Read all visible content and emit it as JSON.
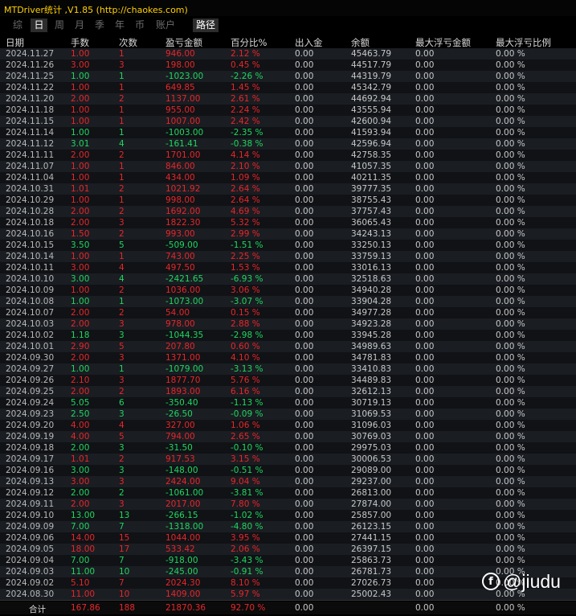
{
  "window": {
    "title": "MTDriver统计 ,V1.85 (http://chaokes.com)"
  },
  "tabs": [
    {
      "label": "综",
      "active": false
    },
    {
      "label": "日",
      "active": true
    },
    {
      "label": "周",
      "active": false
    },
    {
      "label": "月",
      "active": false
    },
    {
      "label": "季",
      "active": false
    },
    {
      "label": "年",
      "active": false
    },
    {
      "label": "币",
      "active": false
    },
    {
      "label": "账户",
      "active": false
    },
    {
      "label": "路径",
      "active": true
    }
  ],
  "columns": [
    "日期",
    "手数",
    "次数",
    "盈亏金额",
    "百分比%",
    "出入金",
    "余额",
    "最大浮亏金额",
    "最大浮亏比例"
  ],
  "rows": [
    [
      "2024.11.27",
      "1.00",
      "1",
      "946.00",
      "2.12 %",
      "0.00",
      "45463.79",
      "0.00",
      "0.00 %"
    ],
    [
      "2024.11.26",
      "3.00",
      "3",
      "198.00",
      "0.45 %",
      "0.00",
      "44517.79",
      "0.00",
      "0.00 %"
    ],
    [
      "2024.11.25",
      "1.00",
      "1",
      "-1023.00",
      "-2.26 %",
      "0.00",
      "44319.79",
      "0.00",
      "0.00 %"
    ],
    [
      "2024.11.22",
      "1.00",
      "1",
      "649.85",
      "1.45 %",
      "0.00",
      "45342.79",
      "0.00",
      "0.00 %"
    ],
    [
      "2024.11.20",
      "2.00",
      "2",
      "1137.00",
      "2.61 %",
      "0.00",
      "44692.94",
      "0.00",
      "0.00 %"
    ],
    [
      "2024.11.18",
      "1.00",
      "1",
      "955.00",
      "2.24 %",
      "0.00",
      "43555.94",
      "0.00",
      "0.00 %"
    ],
    [
      "2024.11.15",
      "1.00",
      "1",
      "1007.00",
      "2.42 %",
      "0.00",
      "42600.94",
      "0.00",
      "0.00 %"
    ],
    [
      "2024.11.14",
      "1.00",
      "1",
      "-1003.00",
      "-2.35 %",
      "0.00",
      "41593.94",
      "0.00",
      "0.00 %"
    ],
    [
      "2024.11.12",
      "3.01",
      "4",
      "-161.41",
      "-0.38 %",
      "0.00",
      "42596.94",
      "0.00",
      "0.00 %"
    ],
    [
      "2024.11.11",
      "2.00",
      "2",
      "1701.00",
      "4.14 %",
      "0.00",
      "42758.35",
      "0.00",
      "0.00 %"
    ],
    [
      "2024.11.07",
      "1.00",
      "1",
      "846.00",
      "2.10 %",
      "0.00",
      "41057.35",
      "0.00",
      "0.00 %"
    ],
    [
      "2024.11.04",
      "1.00",
      "1",
      "434.00",
      "1.09 %",
      "0.00",
      "40211.35",
      "0.00",
      "0.00 %"
    ],
    [
      "2024.10.31",
      "1.01",
      "2",
      "1021.92",
      "2.64 %",
      "0.00",
      "39777.35",
      "0.00",
      "0.00 %"
    ],
    [
      "2024.10.29",
      "1.00",
      "1",
      "998.00",
      "2.64 %",
      "0.00",
      "38755.43",
      "0.00",
      "0.00 %"
    ],
    [
      "2024.10.28",
      "2.00",
      "2",
      "1692.00",
      "4.69 %",
      "0.00",
      "37757.43",
      "0.00",
      "0.00 %"
    ],
    [
      "2024.10.18",
      "2.00",
      "3",
      "1822.30",
      "5.32 %",
      "0.00",
      "36065.43",
      "0.00",
      "0.00 %"
    ],
    [
      "2024.10.16",
      "1.50",
      "2",
      "993.00",
      "2.99 %",
      "0.00",
      "34243.13",
      "0.00",
      "0.00 %"
    ],
    [
      "2024.10.15",
      "3.50",
      "5",
      "-509.00",
      "-1.51 %",
      "0.00",
      "33250.13",
      "0.00",
      "0.00 %"
    ],
    [
      "2024.10.14",
      "1.00",
      "1",
      "743.00",
      "2.25 %",
      "0.00",
      "33759.13",
      "0.00",
      "0.00 %"
    ],
    [
      "2024.10.11",
      "3.00",
      "4",
      "497.50",
      "1.53 %",
      "0.00",
      "33016.13",
      "0.00",
      "0.00 %"
    ],
    [
      "2024.10.10",
      "3.00",
      "4",
      "-2421.65",
      "-6.93 %",
      "0.00",
      "32518.63",
      "0.00",
      "0.00 %"
    ],
    [
      "2024.10.09",
      "1.00",
      "2",
      "1036.00",
      "3.06 %",
      "0.00",
      "34940.28",
      "0.00",
      "0.00 %"
    ],
    [
      "2024.10.08",
      "1.00",
      "1",
      "-1073.00",
      "-3.07 %",
      "0.00",
      "33904.28",
      "0.00",
      "0.00 %"
    ],
    [
      "2024.10.07",
      "2.00",
      "2",
      "54.00",
      "0.15 %",
      "0.00",
      "34977.28",
      "0.00",
      "0.00 %"
    ],
    [
      "2024.10.03",
      "2.00",
      "3",
      "978.00",
      "2.88 %",
      "0.00",
      "34923.28",
      "0.00",
      "0.00 %"
    ],
    [
      "2024.10.02",
      "1.18",
      "3",
      "-1044.35",
      "-2.98 %",
      "0.00",
      "33945.28",
      "0.00",
      "0.00 %"
    ],
    [
      "2024.10.01",
      "2.90",
      "5",
      "207.80",
      "0.60 %",
      "0.00",
      "34989.63",
      "0.00",
      "0.00 %"
    ],
    [
      "2024.09.30",
      "2.00",
      "3",
      "1371.00",
      "4.10 %",
      "0.00",
      "34781.83",
      "0.00",
      "0.00 %"
    ],
    [
      "2024.09.27",
      "1.00",
      "1",
      "-1079.00",
      "-3.13 %",
      "0.00",
      "33410.83",
      "0.00",
      "0.00 %"
    ],
    [
      "2024.09.26",
      "2.10",
      "3",
      "1877.70",
      "5.76 %",
      "0.00",
      "34489.83",
      "0.00",
      "0.00 %"
    ],
    [
      "2024.09.25",
      "2.00",
      "2",
      "1893.00",
      "6.16 %",
      "0.00",
      "32612.13",
      "0.00",
      "0.00 %"
    ],
    [
      "2024.09.24",
      "5.05",
      "6",
      "-350.40",
      "-1.13 %",
      "0.00",
      "30719.13",
      "0.00",
      "0.00 %"
    ],
    [
      "2024.09.23",
      "2.50",
      "3",
      "-26.50",
      "-0.09 %",
      "0.00",
      "31069.53",
      "0.00",
      "0.00 %"
    ],
    [
      "2024.09.20",
      "4.00",
      "4",
      "327.00",
      "1.06 %",
      "0.00",
      "31096.03",
      "0.00",
      "0.00 %"
    ],
    [
      "2024.09.19",
      "4.00",
      "5",
      "794.00",
      "2.65 %",
      "0.00",
      "30769.03",
      "0.00",
      "0.00 %"
    ],
    [
      "2024.09.18",
      "2.00",
      "3",
      "-31.50",
      "-0.10 %",
      "0.00",
      "29975.03",
      "0.00",
      "0.00 %"
    ],
    [
      "2024.09.17",
      "1.01",
      "2",
      "917.53",
      "3.15 %",
      "0.00",
      "30006.53",
      "0.00",
      "0.00 %"
    ],
    [
      "2024.09.16",
      "3.00",
      "3",
      "-148.00",
      "-0.51 %",
      "0.00",
      "29089.00",
      "0.00",
      "0.00 %"
    ],
    [
      "2024.09.13",
      "3.00",
      "3",
      "2424.00",
      "9.04 %",
      "0.00",
      "29237.00",
      "0.00",
      "0.00 %"
    ],
    [
      "2024.09.12",
      "2.00",
      "2",
      "-1061.00",
      "-3.81 %",
      "0.00",
      "26813.00",
      "0.00",
      "0.00 %"
    ],
    [
      "2024.09.11",
      "2.00",
      "3",
      "2017.00",
      "7.80 %",
      "0.00",
      "27874.00",
      "0.00",
      "0.00 %"
    ],
    [
      "2024.09.10",
      "13.00",
      "13",
      "-266.15",
      "-1.02 %",
      "0.00",
      "25857.00",
      "0.00",
      "0.00 %"
    ],
    [
      "2024.09.09",
      "7.00",
      "7",
      "-1318.00",
      "-4.80 %",
      "0.00",
      "26123.15",
      "0.00",
      "0.00 %"
    ],
    [
      "2024.09.06",
      "14.00",
      "15",
      "1044.00",
      "3.95 %",
      "0.00",
      "27441.15",
      "0.00",
      "0.00 %"
    ],
    [
      "2024.09.05",
      "18.00",
      "17",
      "533.42",
      "2.06 %",
      "0.00",
      "26397.15",
      "0.00",
      "0.00 %"
    ],
    [
      "2024.09.04",
      "7.00",
      "7",
      "-918.00",
      "-3.43 %",
      "0.00",
      "25863.73",
      "0.00",
      "0.00 %"
    ],
    [
      "2024.09.03",
      "11.00",
      "10",
      "-245.00",
      "-0.91 %",
      "0.00",
      "26781.73",
      "0.00",
      "0.00 %"
    ],
    [
      "2024.09.02",
      "5.10",
      "7",
      "2024.30",
      "8.10 %",
      "0.00",
      "27026.73",
      "0.00",
      "0.00 %"
    ],
    [
      "2024.08.30",
      "11.00",
      "10",
      "1409.00",
      "5.97 %",
      "0.00",
      "25002.43",
      "0.00",
      "0.00 %"
    ]
  ],
  "total": [
    "合计",
    "167.86",
    "188",
    "21870.36",
    "92.70 %",
    "0.00",
    "",
    "0.00",
    "0.00 %"
  ],
  "colors": {
    "profit": "#e8262a",
    "loss": "#1ed760",
    "title": "#ffd000",
    "background": "#000000"
  },
  "watermark": {
    "icon": "facebook-logo-icon",
    "text": "@jiudu"
  }
}
